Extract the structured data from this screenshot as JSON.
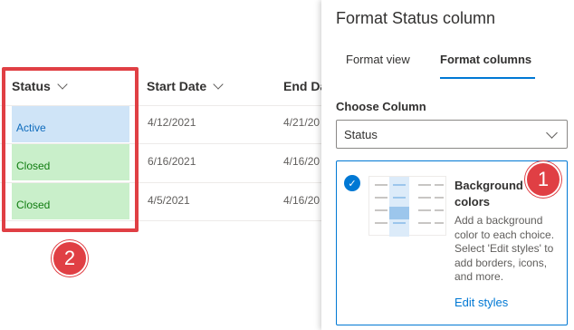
{
  "list": {
    "columns": [
      {
        "label": "Status"
      },
      {
        "label": "Start Date"
      },
      {
        "label": "End Da"
      }
    ],
    "rows": [
      {
        "status": "Active",
        "status_bg": "#cfe4f7",
        "status_color": "#0f6cbd",
        "start": "4/12/2021",
        "end": "4/21/20"
      },
      {
        "status": "Closed",
        "status_bg": "#c9efca",
        "status_color": "#107c10",
        "start": "6/16/2021",
        "end": "4/16/20"
      },
      {
        "status": "Closed",
        "status_bg": "#c9efca",
        "status_color": "#107c10",
        "start": "4/5/2021",
        "end": "4/16/20"
      }
    ]
  },
  "annotations": {
    "badge1": "1",
    "badge2": "2",
    "highlight_color": "#e03f44"
  },
  "panel": {
    "title": "Format Status column",
    "tabs": [
      {
        "label": "Format view",
        "active": false
      },
      {
        "label": "Format columns",
        "active": true
      }
    ],
    "choose_label": "Choose Column",
    "column_select": {
      "value": "Status",
      "icon": "chevron-down-icon"
    },
    "option_card": {
      "checked": true,
      "check_icon": "checkmark-icon",
      "title": "Background colors",
      "description": "Add a background color to each choice. Select 'Edit styles' to add borders, icons, and more.",
      "link": "Edit styles"
    }
  },
  "colors": {
    "accent": "#0078d4",
    "annotation_red": "#e03f44"
  }
}
